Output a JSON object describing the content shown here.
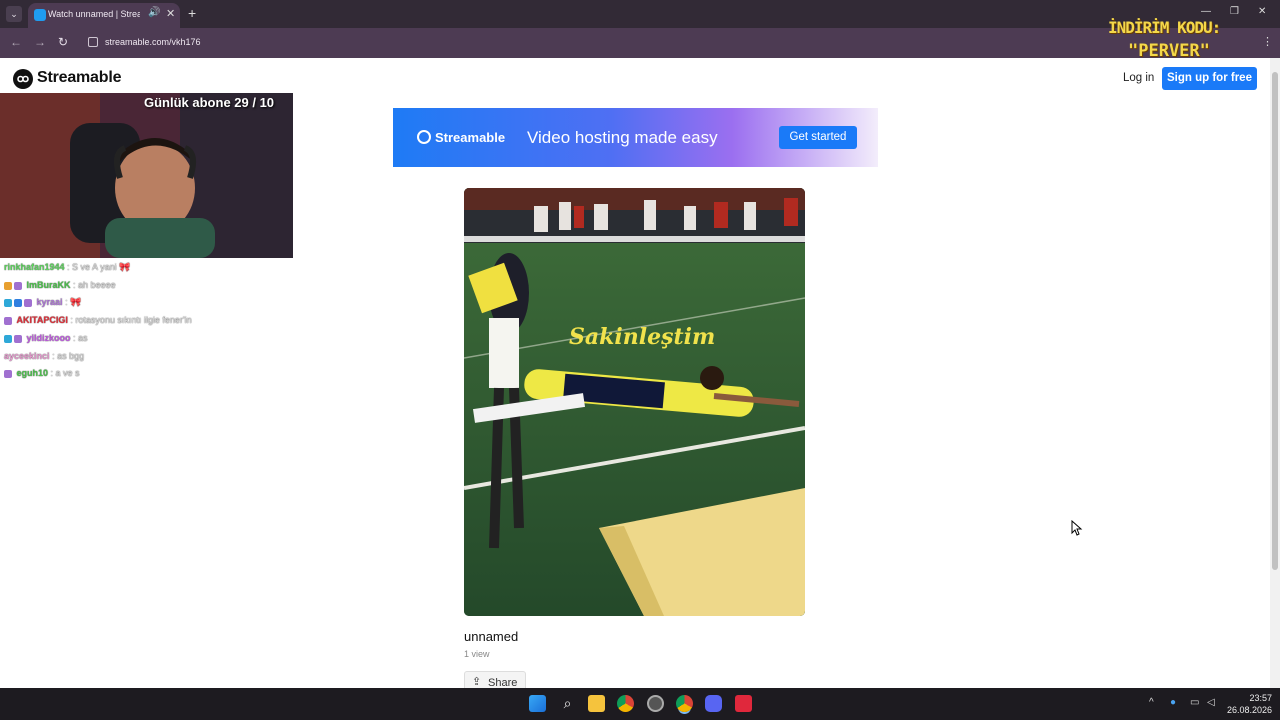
{
  "browser": {
    "tab_title": "Watch unnamed | Streamable",
    "url": "streamable.com/vkh176"
  },
  "promo_overlay": {
    "line1": "İNDİRİM KODU:",
    "line2": "\"PERVER\""
  },
  "site": {
    "logo_text": "Streamable",
    "login_label": "Log in",
    "signup_label": "Sign up for free"
  },
  "banner": {
    "brand": "Streamable",
    "tagline": "Video hosting made easy",
    "cta": "Get started"
  },
  "video": {
    "caption": "Sakinleştim",
    "title": "unnamed",
    "views": "1 view",
    "share_label": "Share"
  },
  "stream_overlay": {
    "sub_goal": "Günlük abone 29 / 10",
    "chat": [
      {
        "user": "rinkhafan1944",
        "msg": ": S ve A yani 🎀",
        "color": "#5fd35f"
      },
      {
        "user": "ImBuraKK",
        "msg": ": ah beeee",
        "color": "#4ec24e"
      },
      {
        "user": "kyraai",
        "msg": ": 🎀",
        "color": "#b07ad8"
      },
      {
        "user": "AKITAPCIGI",
        "msg": ": rotasyonu sıkıntı ilgie fener'in",
        "color": "#e0303a"
      },
      {
        "user": "yildizkooo",
        "msg": ": as",
        "color": "#c060e0"
      },
      {
        "user": "ayceekinci",
        "msg": ": as bgg",
        "color": "#e89bd0"
      },
      {
        "user": "eguh10",
        "msg": ": a ve s",
        "color": "#4ec24e"
      }
    ]
  },
  "taskbar": {
    "time": "23:57",
    "date": "26.08.2026"
  }
}
